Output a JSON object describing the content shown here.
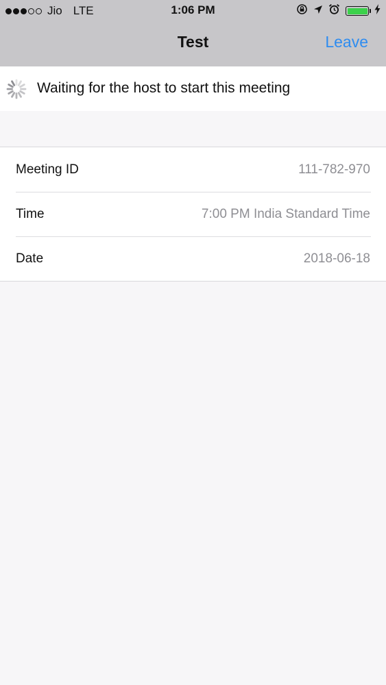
{
  "status_bar": {
    "carrier": "Jio",
    "network": "LTE",
    "time": "1:06 PM",
    "signal_bars_filled": 3,
    "signal_bars_total": 5,
    "icons": [
      "orientation-lock-icon",
      "location-arrow-icon",
      "alarm-icon",
      "battery-icon",
      "charging-bolt-icon"
    ],
    "battery_level": 1.0,
    "battery_color": "#3bd14b"
  },
  "nav": {
    "title": "Test",
    "leave_label": "Leave",
    "accent_color": "#2e8cf0"
  },
  "waiting": {
    "icon": "loading-spinner-icon",
    "message": "Waiting for the host to start this meeting"
  },
  "details": {
    "rows": [
      {
        "label": "Meeting ID",
        "value": "111-782-970"
      },
      {
        "label": "Time",
        "value": "7:00 PM India Standard Time"
      },
      {
        "label": "Date",
        "value": "2018-06-18"
      }
    ]
  }
}
